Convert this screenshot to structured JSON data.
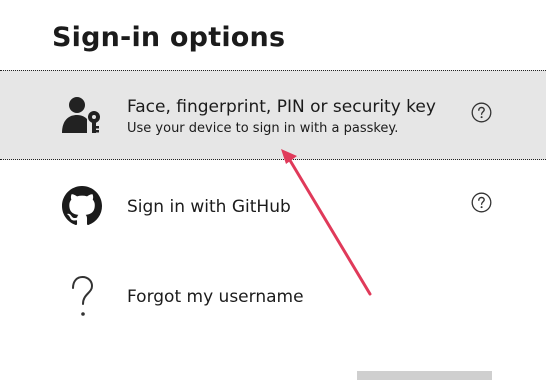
{
  "header": {
    "title": "Sign-in options"
  },
  "options": [
    {
      "label": "Face, fingerprint, PIN or security key",
      "description": "Use your device to sign in with a passkey.",
      "icon": "user-key-icon",
      "selected": true
    },
    {
      "label": "Sign in with GitHub",
      "icon": "github-icon",
      "selected": false
    },
    {
      "label": "Forgot my username",
      "icon": "question-mark-icon",
      "selected": false
    }
  ],
  "colors": {
    "selected_background": "#e6e6e6",
    "annotation_arrow": "#e03a5a",
    "text": "#1b1b1b"
  }
}
